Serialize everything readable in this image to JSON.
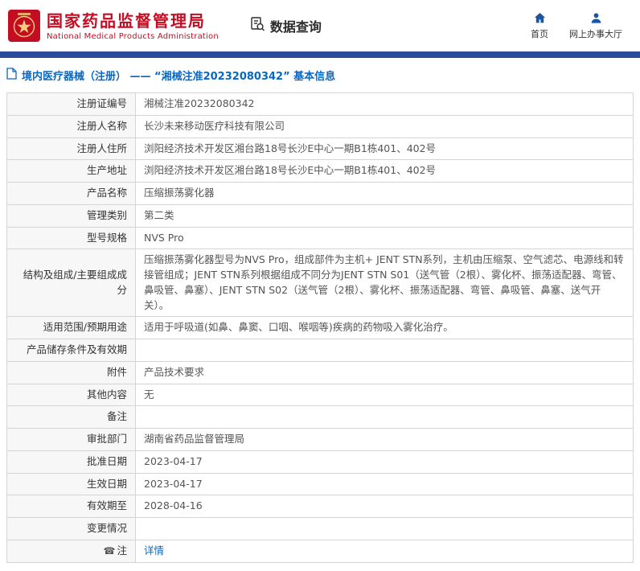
{
  "header": {
    "agency_cn": "国家药品监督管理局",
    "agency_en": "National Medical Products Administration",
    "section_title": "数据查询",
    "nav_home": "首页",
    "nav_hall": "网上办事大厅"
  },
  "colors": {
    "brand_red": "#c30d23",
    "bar_blue": "#2c4a9d",
    "link_blue": "#0a67c2",
    "nav_icon_blue": "#1a56a8"
  },
  "breadcrumb": {
    "text": "境内医疗器械（注册） —— “湘械注准20232080342” 基本信息"
  },
  "table": {
    "note_icon": "☎",
    "rows": [
      {
        "label": "注册证编号",
        "value": "湘械注准20232080342"
      },
      {
        "label": "注册人名称",
        "value": "长沙未来移动医疗科技有限公司"
      },
      {
        "label": "注册人住所",
        "value": "浏阳经济技术开发区湘台路18号长沙E中心一期B1栋401、402号"
      },
      {
        "label": "生产地址",
        "value": "浏阳经济技术开发区湘台路18号长沙E中心一期B1栋401、402号"
      },
      {
        "label": "产品名称",
        "value": "压缩振荡雾化器"
      },
      {
        "label": "管理类别",
        "value": "第二类"
      },
      {
        "label": "型号规格",
        "value": "NVS Pro"
      },
      {
        "label": "结构及组成/主要组成成分",
        "value": "压缩振荡雾化器型号为NVS Pro，组成部件为主机+ JENT STN系列，主机由压缩泵、空气滤芯、电源线和转接管组成；JENT STN系列根据组成不同分为JENT STN S01（送气管（2根）、雾化杯、振荡适配器、弯管、鼻吸管、鼻塞）、JENT STN S02（送气管（2根）、雾化杯、振荡适配器、弯管、鼻吸管、鼻塞、送气开关）。"
      },
      {
        "label": "适用范围/预期用途",
        "value": "适用于呼吸道(如鼻、鼻窦、口咽、喉咽等)疾病的药物吸入雾化治疗。"
      },
      {
        "label": "产品储存条件及有效期",
        "value": ""
      },
      {
        "label": "附件",
        "value": "产品技术要求"
      },
      {
        "label": "其他内容",
        "value": "无"
      },
      {
        "label": "备注",
        "value": ""
      },
      {
        "label": "审批部门",
        "value": "湖南省药品监督管理局"
      },
      {
        "label": "批准日期",
        "value": "2023-04-17"
      },
      {
        "label": "生效日期",
        "value": "2023-04-17"
      },
      {
        "label": "有效期至",
        "value": "2028-04-16"
      },
      {
        "label": "变更情况",
        "value": ""
      },
      {
        "label": "注",
        "value": "详情"
      }
    ]
  }
}
